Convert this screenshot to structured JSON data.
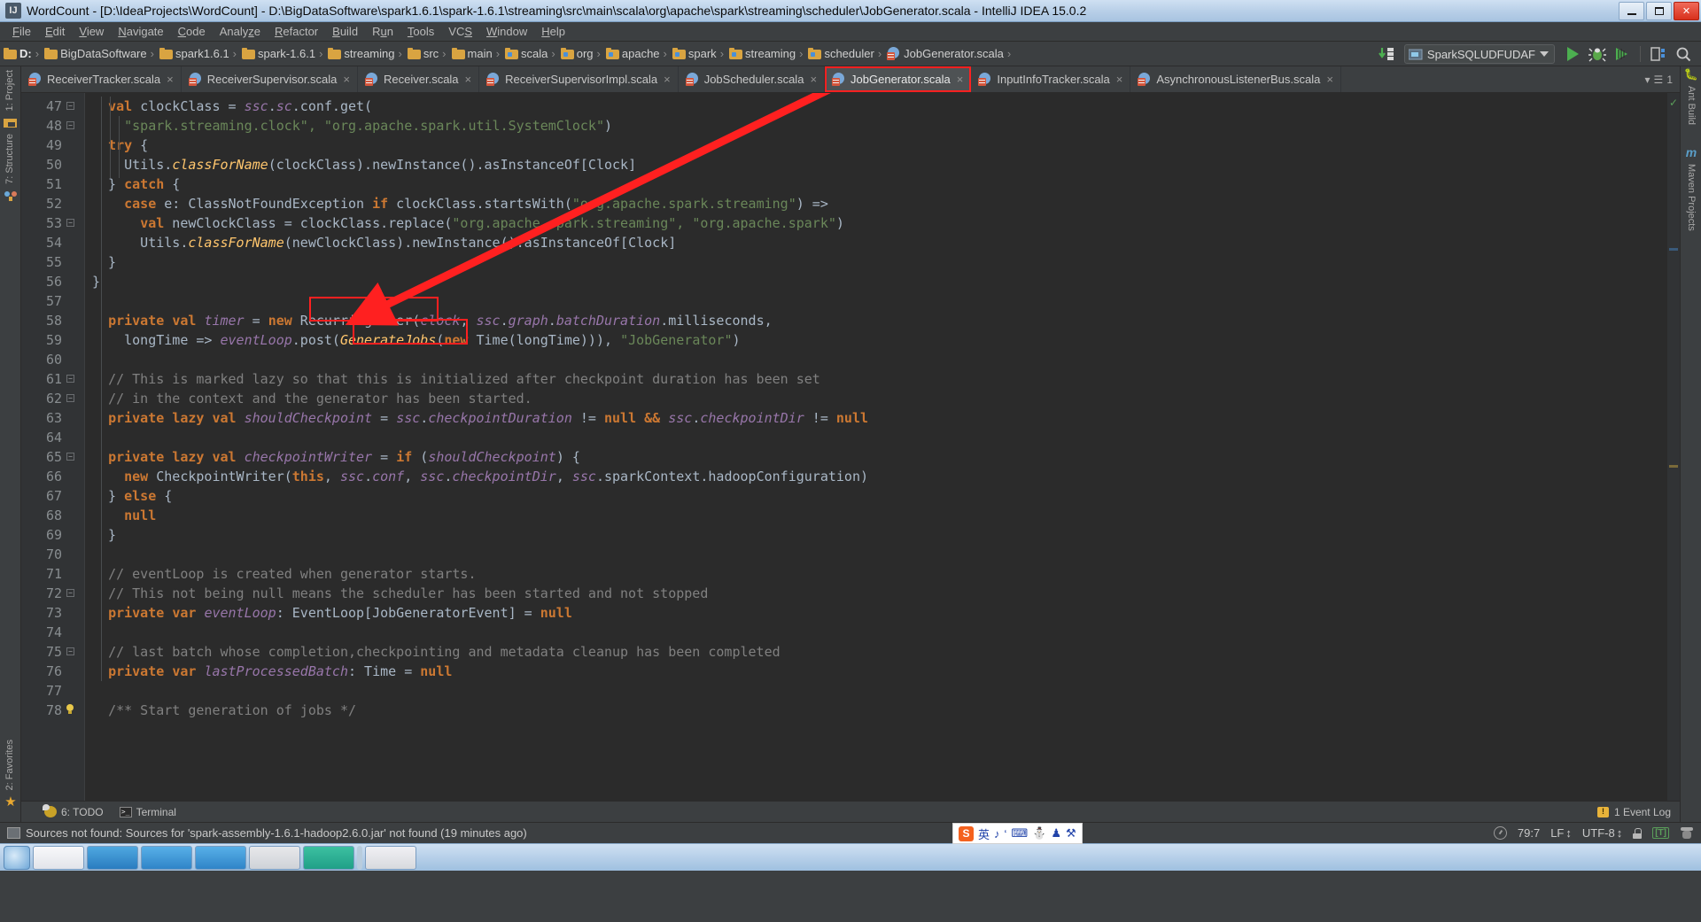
{
  "window": {
    "title": "WordCount - [D:\\IdeaProjects\\WordCount] - D:\\BigDataSoftware\\spark1.6.1\\spark-1.6.1\\streaming\\src\\main\\scala\\org\\apache\\spark\\streaming\\scheduler\\JobGenerator.scala - IntelliJ IDEA 15.0.2",
    "app_icon": "idea-icon",
    "minimize_label": "—",
    "maximize_label": "❐",
    "close_label": "✕"
  },
  "menubar": {
    "items": [
      {
        "label": "File"
      },
      {
        "label": "Edit"
      },
      {
        "label": "View"
      },
      {
        "label": "Navigate"
      },
      {
        "label": "Code"
      },
      {
        "label": "Analyze"
      },
      {
        "label": "Refactor"
      },
      {
        "label": "Build"
      },
      {
        "label": "Run"
      },
      {
        "label": "Tools"
      },
      {
        "label": "VCS"
      },
      {
        "label": "Window"
      },
      {
        "label": "Help"
      }
    ]
  },
  "navbar": {
    "crumbs": [
      {
        "label": "D:",
        "icon": "folder-icon"
      },
      {
        "label": "BigDataSoftware",
        "icon": "folder-icon"
      },
      {
        "label": "spark1.6.1",
        "icon": "folder-icon"
      },
      {
        "label": "spark-1.6.1",
        "icon": "folder-icon"
      },
      {
        "label": "streaming",
        "icon": "folder-icon"
      },
      {
        "label": "src",
        "icon": "folder-icon"
      },
      {
        "label": "main",
        "icon": "folder-icon"
      },
      {
        "label": "scala",
        "icon": "source-folder-icon"
      },
      {
        "label": "org",
        "icon": "source-folder-icon"
      },
      {
        "label": "apache",
        "icon": "source-folder-icon"
      },
      {
        "label": "spark",
        "icon": "source-folder-icon"
      },
      {
        "label": "streaming",
        "icon": "source-folder-icon"
      },
      {
        "label": "scheduler",
        "icon": "source-folder-icon"
      },
      {
        "label": "JobGenerator.scala",
        "icon": "scala-file-icon"
      }
    ],
    "separator": "›",
    "run_config": "SparkSQLUDFUDAF",
    "buttons": [
      {
        "name": "update-project-button",
        "glyph": "↓"
      },
      {
        "name": "run-button",
        "glyph": "▶"
      },
      {
        "name": "debug-button",
        "glyph": "☢"
      },
      {
        "name": "run-coverage-button",
        "glyph": "▶"
      },
      {
        "name": "open-settings-button",
        "glyph": "⚙"
      },
      {
        "name": "search-everywhere-button",
        "glyph": "⌕"
      }
    ]
  },
  "left_strip": {
    "tabs": [
      {
        "label": "1: Project",
        "icon": "project-icon"
      },
      {
        "label": "7: Structure",
        "icon": "structure-icon"
      },
      {
        "label": "2: Favorites",
        "icon": "star-icon"
      }
    ]
  },
  "right_strip": {
    "tabs": [
      {
        "label": "Ant Build",
        "icon": "ant-icon"
      },
      {
        "label": "Maven Projects",
        "icon": "maven-icon"
      }
    ]
  },
  "editor_tabs": {
    "items": [
      {
        "label": "ReceiverTracker.scala",
        "active": false,
        "highlighted": false
      },
      {
        "label": "ReceiverSupervisor.scala",
        "active": false,
        "highlighted": false
      },
      {
        "label": "Receiver.scala",
        "active": false,
        "highlighted": false
      },
      {
        "label": "ReceiverSupervisorImpl.scala",
        "active": false,
        "highlighted": false
      },
      {
        "label": "JobScheduler.scala",
        "active": false,
        "highlighted": false
      },
      {
        "label": "JobGenerator.scala",
        "active": true,
        "highlighted": true
      },
      {
        "label": "InputInfoTracker.scala",
        "active": false,
        "highlighted": false
      },
      {
        "label": "AsynchronousListenerBus.scala",
        "active": false,
        "highlighted": false
      }
    ],
    "close_glyph": "×",
    "more_label": "1"
  },
  "code": {
    "first_line_number": 47,
    "lines": [
      {
        "n": 47,
        "html": "  <span class='kw'>val</span> <span class='id'>clockClass</span> = <span class='fld'>ssc</span>.<span class='fld'>sc</span>.conf.get("
      },
      {
        "n": 48,
        "html": "    <span class='str'>\"spark.streaming.clock\"</span><span class='str'>,</span> <span class='str'>\"org.apache.spark.util.SystemClock\"</span>)"
      },
      {
        "n": 49,
        "html": "  <span class='kw'>try</span> {"
      },
      {
        "n": 50,
        "html": "    Utils.<span class='mth'>classForName</span>(clockClass).newInstance().asInstanceOf[Clock]"
      },
      {
        "n": 51,
        "html": "  } <span class='kw'>catch</span> {"
      },
      {
        "n": 52,
        "html": "    <span class='kw'>case</span> e: ClassNotFoundException <span class='kw'>if</span> clockClass.startsWith(<span class='str'>\"org.apache.spark.streaming\"</span>) =>"
      },
      {
        "n": 53,
        "html": "      <span class='kw'>val</span> newClockClass = clockClass.replace(<span class='str'>\"org.apache.spark.streaming\"</span><span class='str'>, </span><span class='str'>\"org.apache.spark\"</span>)"
      },
      {
        "n": 54,
        "html": "      Utils.<span class='mth'>classForName</span>(newClockClass).newInstance().asInstanceOf[Clock]"
      },
      {
        "n": 55,
        "html": "  }"
      },
      {
        "n": 56,
        "html": "}"
      },
      {
        "n": 57,
        "html": ""
      },
      {
        "n": 58,
        "html": "  <span class='kw'>private</span> <span class='kw'>val</span> <span class='fld'>timer</span> = <span class='kw'>new</span> RecurringTimer(<span class='fld'>clock</span><span class='id'>,</span> <span class='fld'>ssc</span>.<span class='fld'>graph</span>.<span class='fld'>batchDuration</span>.milliseconds<span class='id'>,</span>"
      },
      {
        "n": 59,
        "html": "    longTime => <span class='fld'>eventLoop</span>.post(<span class='mth'>GenerateJobs</span>(<span class='kw'>new</span> Time(longTime)))<span class='id'>,</span> <span class='str'>\"JobGenerator\"</span>)"
      },
      {
        "n": 60,
        "html": ""
      },
      {
        "n": 61,
        "html": "  <span class='cmt'>// This is marked lazy so that this is initialized after checkpoint duration has been set</span>"
      },
      {
        "n": 62,
        "html": "  <span class='cmt'>// in the context and the generator has been started.</span>"
      },
      {
        "n": 63,
        "html": "  <span class='kw'>private</span> <span class='kw'>lazy</span> <span class='kw'>val</span> <span class='fld'>shouldCheckpoint</span> = <span class='fld'>ssc</span>.<span class='fld'>checkpointDuration</span> != <span class='kw'>null</span> <span class='kw'>&&</span> <span class='fld'>ssc</span>.<span class='fld'>checkpointDir</span> != <span class='kw'>null</span>"
      },
      {
        "n": 64,
        "html": ""
      },
      {
        "n": 65,
        "html": "  <span class='kw'>private</span> <span class='kw'>lazy</span> <span class='kw'>val</span> <span class='fld'>checkpointWriter</span> = <span class='kw'>if</span> (<span class='fld'>shouldCheckpoint</span>) {"
      },
      {
        "n": 66,
        "html": "    <span class='kw'>new</span> CheckpointWriter(<span class='kw'>this</span><span class='id'>,</span> <span class='fld'>ssc</span>.<span class='fld'>conf</span><span class='id'>,</span> <span class='fld'>ssc</span>.<span class='fld'>checkpointDir</span><span class='id'>,</span> <span class='fld'>ssc</span>.sparkContext.hadoopConfiguration)"
      },
      {
        "n": 67,
        "html": "  } <span class='kw'>else</span> {"
      },
      {
        "n": 68,
        "html": "    <span class='kw'>null</span>"
      },
      {
        "n": 69,
        "html": "  }"
      },
      {
        "n": 70,
        "html": ""
      },
      {
        "n": 71,
        "html": "  <span class='cmt'>// eventLoop is created when generator starts.</span>"
      },
      {
        "n": 72,
        "html": "  <span class='cmt'>// This not being null means the scheduler has been started and not stopped</span>"
      },
      {
        "n": 73,
        "html": "  <span class='kw'>private</span> <span class='kw'>var</span> <span class='fld'>eventLoop</span>: EventLoop[JobGeneratorEvent] = <span class='kw'>null</span>"
      },
      {
        "n": 74,
        "html": ""
      },
      {
        "n": 75,
        "html": "  <span class='cmt'>// last batch whose completion,checkpointing and metadata cleanup has been completed</span>"
      },
      {
        "n": 76,
        "html": "  <span class='kw'>private</span> <span class='kw'>var</span> <span class='fld'>lastProcessedBatch</span>: Time = <span class='kw'>null</span>"
      },
      {
        "n": 77,
        "html": ""
      },
      {
        "n": 78,
        "html": "  <span class='cmt'>/** Start generation of jobs */</span>"
      }
    ],
    "annotations": [
      {
        "name": "recurring-timer-highlight",
        "label": "RecurringTimer"
      },
      {
        "name": "generate-jobs-highlight",
        "label": "GenerateJobs"
      },
      {
        "name": "tab-highlight",
        "label": "JobGenerator.scala"
      },
      {
        "name": "red-arrow",
        "label": "arrow from tab to RecurringTimer"
      }
    ]
  },
  "bottom_toolwindows": {
    "items": [
      {
        "label": "6: TODO",
        "icon": "todo-icon"
      },
      {
        "label": "Terminal",
        "icon": "terminal-icon"
      }
    ],
    "event_log": "1 Event Log"
  },
  "statusbar": {
    "message": "Sources not found: Sources for 'spark-assembly-1.6.1-hadoop2.6.0.jar' not found (19 minutes ago)",
    "caret_position": "79:7",
    "line_separator": "LF",
    "encoding": "UTF-8",
    "lock_state": "unlocked",
    "ime": {
      "brand": "S",
      "mode": "英",
      "tools": [
        "♪",
        "‘",
        "⌨",
        "⛄",
        "♟",
        "⚒"
      ]
    }
  },
  "colors": {
    "editor_bg": "#2b2b2b",
    "gutter_bg": "#313335",
    "chrome_bg": "#3c3f41",
    "accent_red": "#ff2020",
    "keyword": "#cc7832",
    "string": "#6a8759",
    "comment": "#808080",
    "field": "#9876aa",
    "method": "#ffc66d",
    "default_text": "#a9b7c6",
    "titlebar": "#b9d0e8"
  }
}
